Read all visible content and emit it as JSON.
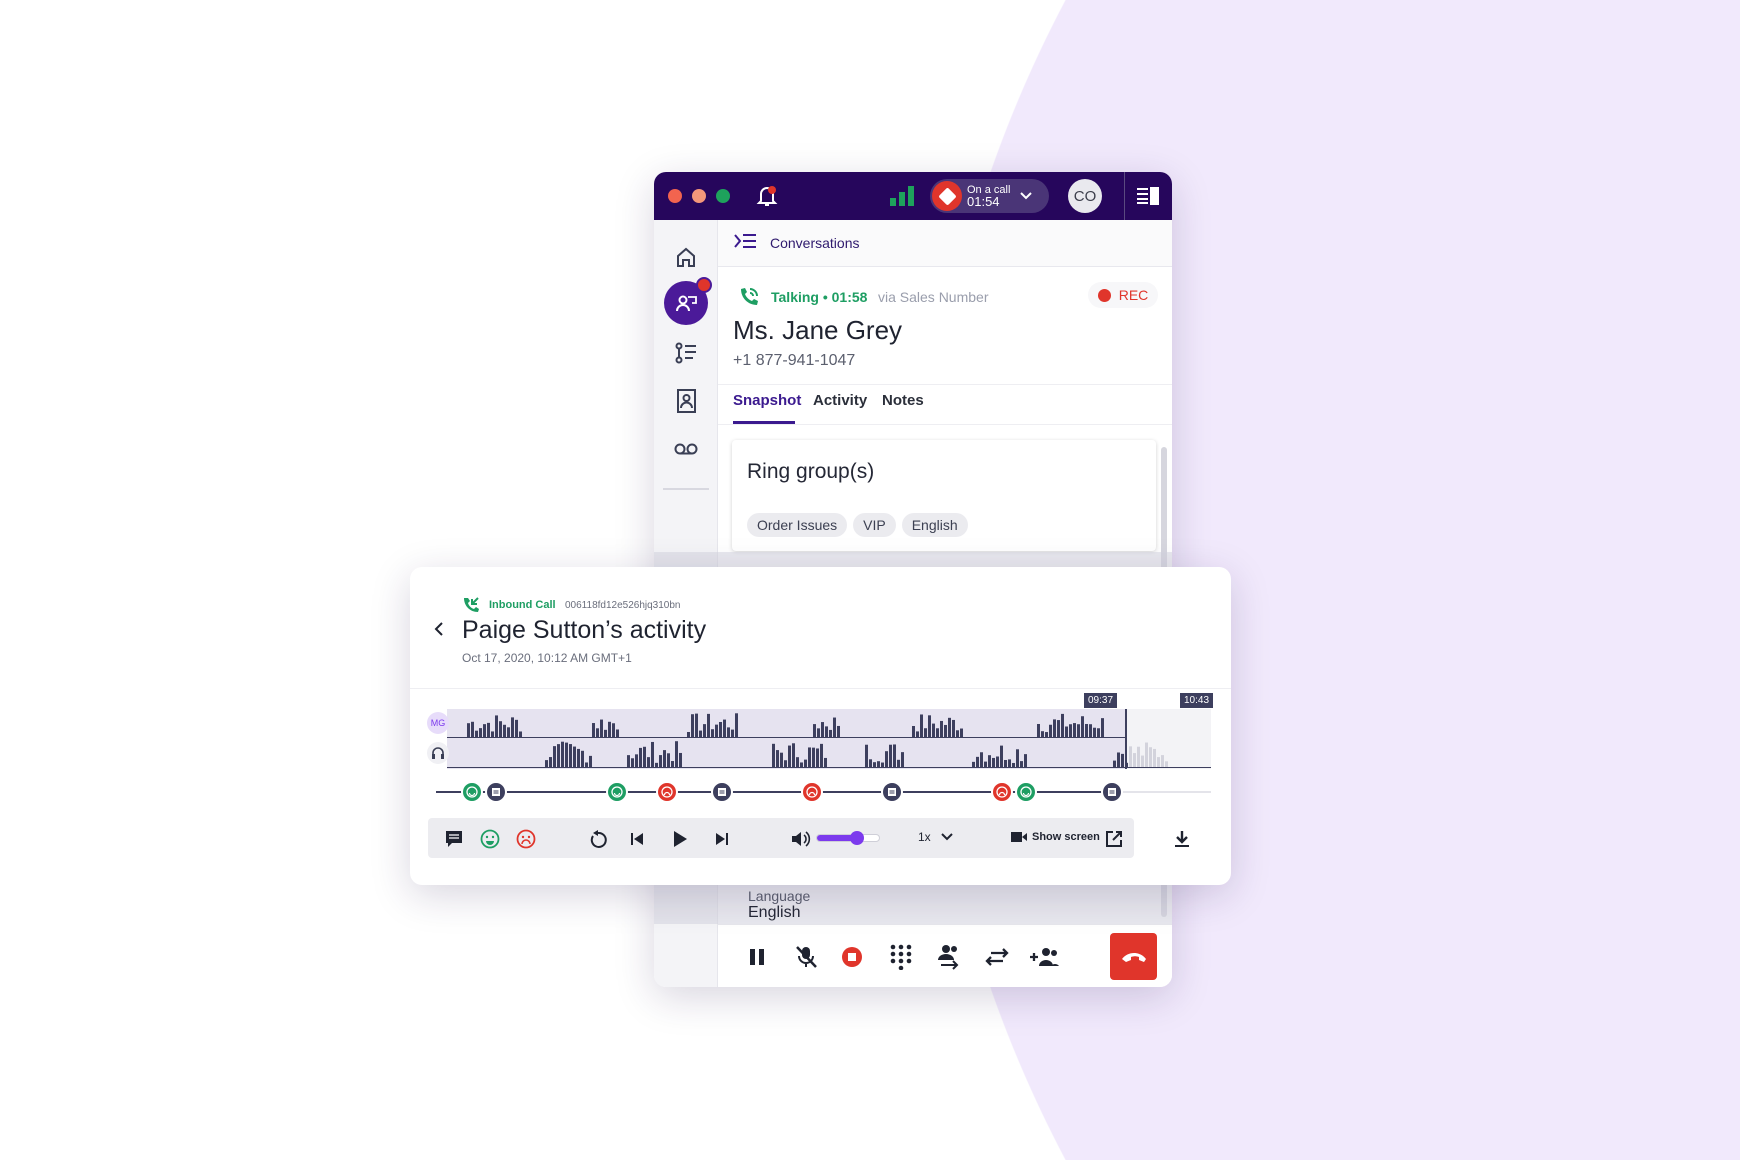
{
  "colors": {
    "brand": "#26065c",
    "accent": "#5b21b6",
    "talking": "#1e9e63",
    "rec": "#e0352b",
    "background_blob": "#f1e9fc"
  },
  "titlebar": {
    "call_status": "On a call",
    "call_timer": "01:54",
    "avatar_initials": "CO",
    "icons": [
      "bell-icon",
      "signal-icon",
      "chevron-down-icon",
      "panel-icon"
    ]
  },
  "sidebar": {
    "items": [
      "home-icon",
      "conversations-icon",
      "activity-list-icon",
      "contacts-icon",
      "voicemail-icon"
    ]
  },
  "header": {
    "title": "Conversations"
  },
  "call": {
    "status": "Talking • 01:58",
    "via": "via Sales Number",
    "rec_label": "REC",
    "name": "Ms. Jane Grey",
    "phone": "+1 877-941-1047"
  },
  "tabs": [
    {
      "label": "Snapshot",
      "active": true
    },
    {
      "label": "Activity",
      "active": false
    },
    {
      "label": "Notes",
      "active": false
    }
  ],
  "ring_groups": {
    "title": "Ring group(s)",
    "chips": [
      "Order Issues",
      "VIP",
      "English"
    ]
  },
  "language": {
    "label": "Language",
    "value": "English"
  },
  "call_controls": [
    "pause-icon",
    "mute-icon",
    "stop-record-icon",
    "dialpad-icon",
    "transfer-icon",
    "swap-icon",
    "add-participant-icon",
    "hang-up-icon"
  ],
  "activity": {
    "type": "Inbound Call",
    "call_id": "006118fd12e526hjq310bn",
    "title": "Paige Sutton’s activity",
    "date": "Oct 17,  2020, 10:12 AM GMT+1",
    "speaker_initials": "MG",
    "current_time": "09:37",
    "total_time": "10:43",
    "progress_fraction": 0.9,
    "markers": [
      "happy",
      "comment",
      "happy",
      "sad",
      "comment",
      "sad",
      "comment",
      "sad",
      "happy",
      "comment"
    ],
    "volume_fraction": 0.65,
    "speed": "1x",
    "show_screen": "Show screen"
  }
}
